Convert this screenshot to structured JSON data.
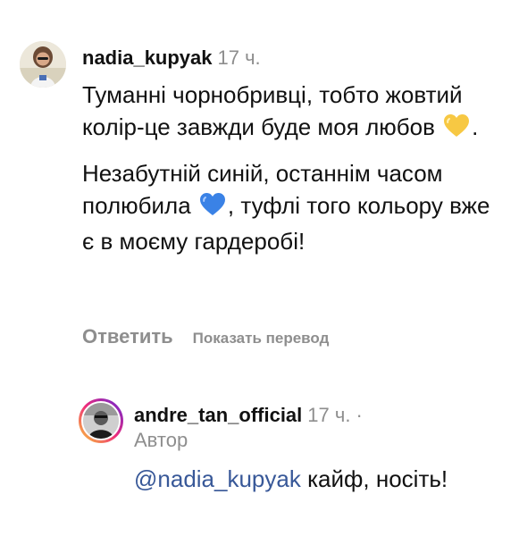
{
  "comments": [
    {
      "username": "nadia_kupyak",
      "time": "17 ч.",
      "paragraph1_text": "Туманні чорнобривці, тобто жовтий колір-це завжди буде моя любов",
      "paragraph1_emoji": "yellow-heart",
      "paragraph1_end": ".",
      "paragraph2_text": "Незабутній синій, останнім часом полюбила",
      "paragraph2_emoji": "blue-heart",
      "paragraph2_end": ", туфлі того кольору вже є в моєму гардеробі!",
      "reply_label": "Ответить",
      "translate_label": "Показать перевод"
    },
    {
      "username": "andre_tan_official",
      "time": "17 ч.",
      "dot": "·",
      "author_badge": "Автор",
      "mention": "@nadia_kupyak",
      "text": " кайф, носіть!"
    }
  ],
  "colors": {
    "yellow_heart": "#f7c843",
    "blue_heart": "#3a82e6",
    "muted": "#8e8e8e",
    "mention": "#385898"
  }
}
